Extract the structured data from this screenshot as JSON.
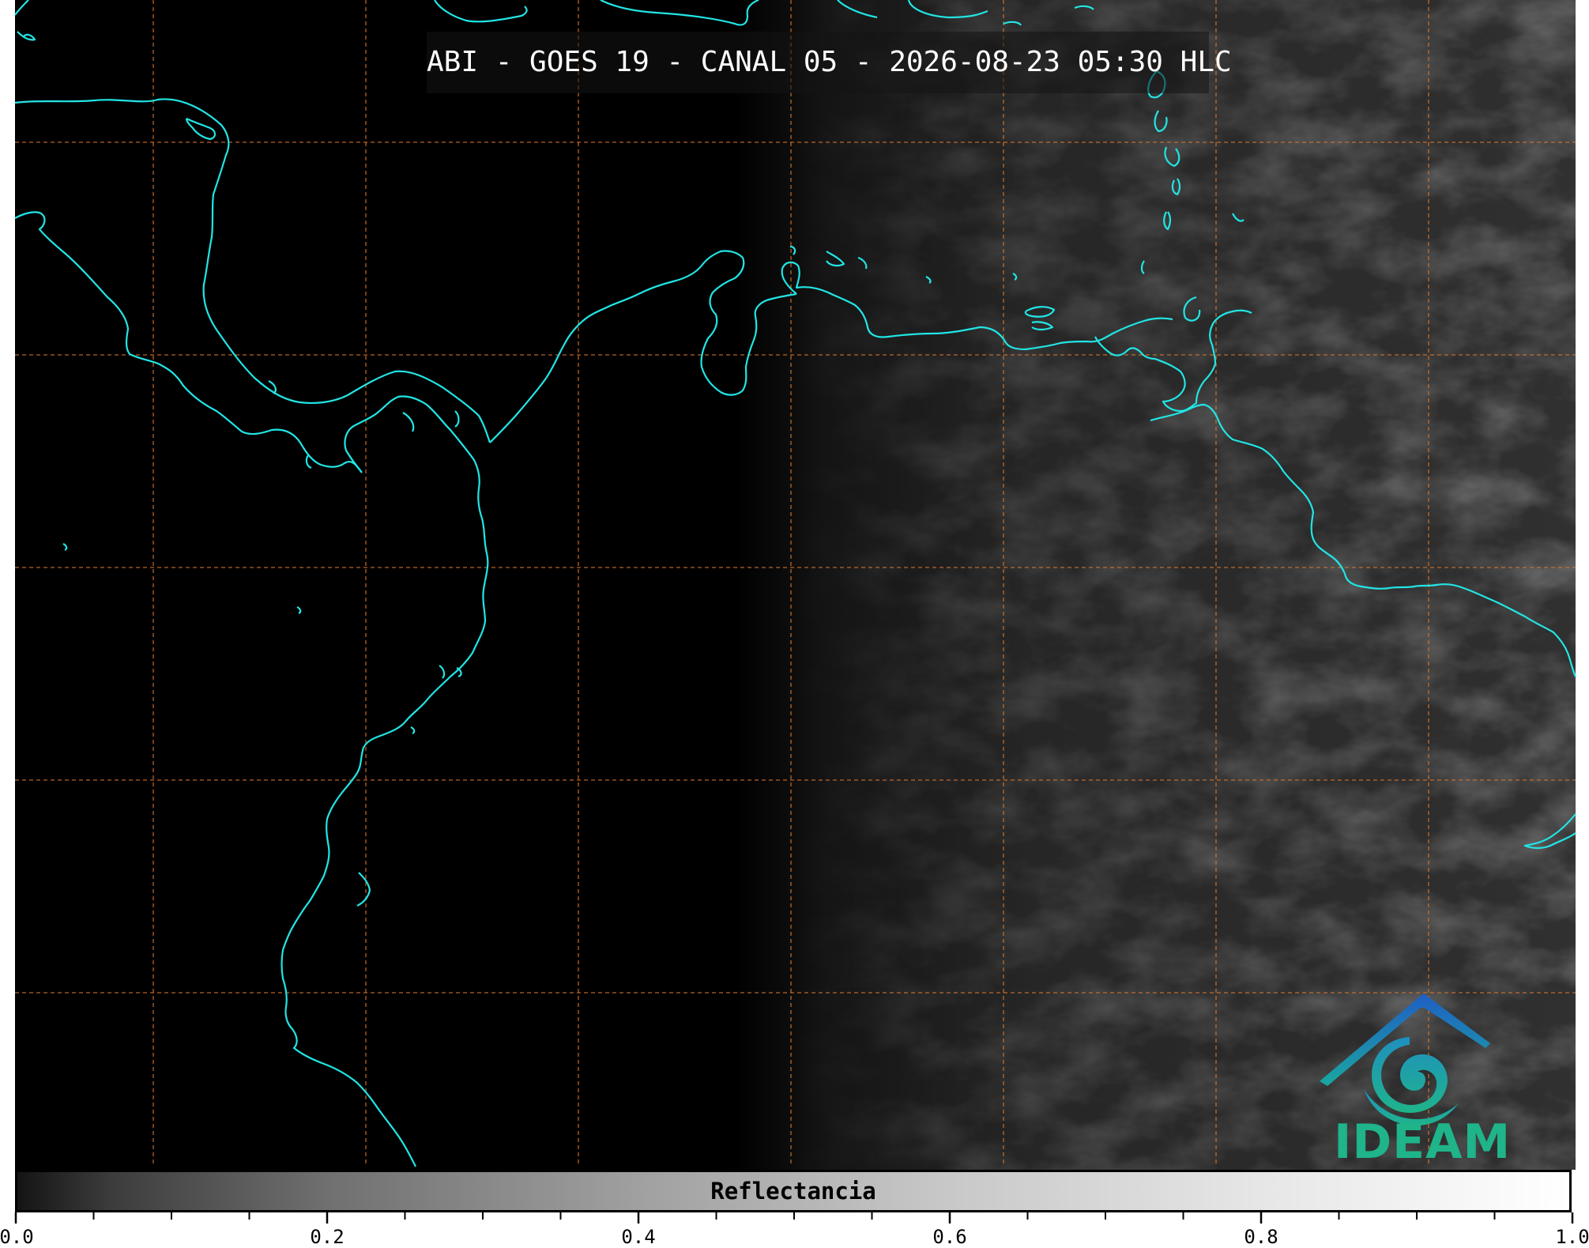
{
  "title": "ABI - GOES 19 - CANAL 05 - 2026-08-23 05:30 HLC",
  "colorbar": {
    "label": "Reflectancia",
    "min": 0.0,
    "max": 1.0,
    "tick_labels": [
      "0.0",
      "0.2",
      "0.4",
      "0.6",
      "0.8",
      "1.0"
    ],
    "tick_values": [
      0.0,
      0.2,
      0.4,
      0.6,
      0.8,
      1.0
    ],
    "minor_tick_step": 0.05,
    "colormap": "grayscale"
  },
  "map": {
    "coastline_color": "#22e5e5",
    "grid_color": "#d9762a",
    "grid_style": "dashed",
    "background_color": "#000000"
  },
  "logo": {
    "text": "IDEAM",
    "text_color": "#1fb48a",
    "roof_color": "#1f73c4"
  }
}
